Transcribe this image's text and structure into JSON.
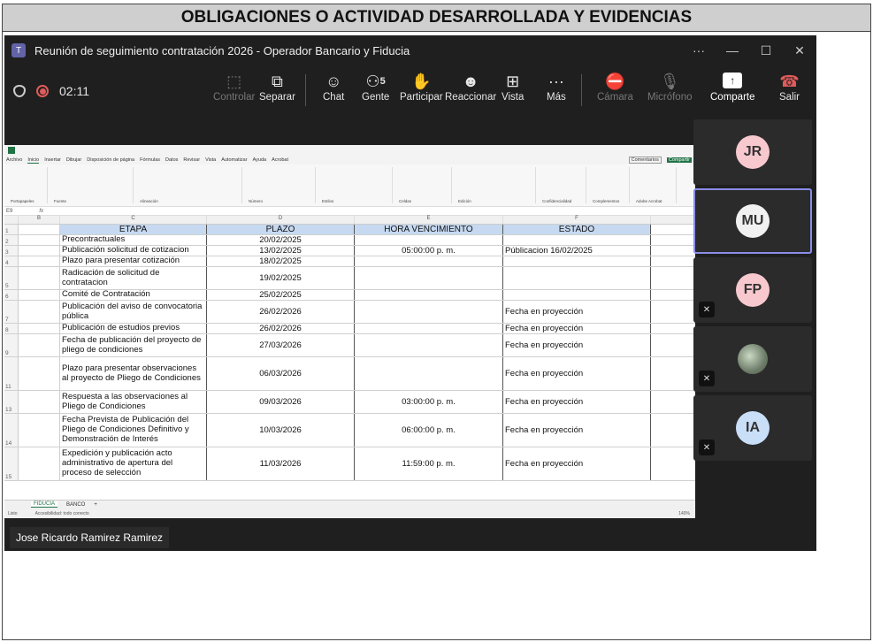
{
  "header": {
    "title": "OBLIGACIONES O ACTIVIDAD DESARROLLADA Y EVIDENCIAS"
  },
  "window": {
    "title": "Reunión de seguimiento contratación 2026 - Operador Bancario y Fiducia",
    "controls": [
      "···",
      "—",
      "☐",
      "✕"
    ]
  },
  "meeting": {
    "timer": "02:11",
    "people_count": "5",
    "buttons": [
      {
        "label": "Controlar",
        "icon": "control-icon"
      },
      {
        "label": "Separar",
        "icon": "popout-icon"
      },
      {
        "label": "Chat",
        "icon": "chat-icon"
      },
      {
        "label": "Gente",
        "icon": "people-icon"
      },
      {
        "label": "Participar",
        "icon": "raise-hand-icon"
      },
      {
        "label": "Reaccionar",
        "icon": "emoji-icon"
      },
      {
        "label": "Vista",
        "icon": "grid-icon"
      },
      {
        "label": "Más",
        "icon": "more-icon"
      },
      {
        "label": "Cámara",
        "icon": "camera-off-icon"
      },
      {
        "label": "Micrófono",
        "icon": "mic-off-icon"
      },
      {
        "label": "Comparte",
        "icon": "share-icon"
      },
      {
        "label": "Salir",
        "icon": "hangup-icon"
      }
    ]
  },
  "excel": {
    "menu": [
      "Archivo",
      "Inicio",
      "Insertar",
      "Dibujar",
      "Disposición de página",
      "Fórmulas",
      "Datos",
      "Revisar",
      "Vista",
      "Automatizar",
      "Ayuda",
      "Acrobat"
    ],
    "ribbon_groups": [
      "Portapapeles",
      "Fuente",
      "Alineación",
      "Número",
      "Estilos",
      "Celdas",
      "Edición",
      "Confidencialidad",
      "Complementos",
      "Adobe Acrobat"
    ],
    "ribbon_buttons": [
      "Comentarios",
      "Compartir"
    ],
    "cell_ref": "E9",
    "formula_prefix": "fx",
    "columns": [
      "B",
      "C",
      "D",
      "E",
      "F"
    ],
    "headers": {
      "etapa": "ETAPA",
      "plazo": "PLAZO",
      "hora": "HORA VENCIMIENTO",
      "estado": "ESTADO"
    },
    "rows": [
      {
        "n": "2",
        "etapa": "Precontractuales",
        "plazo": "20/02/2025",
        "hora": "",
        "estado": ""
      },
      {
        "n": "3",
        "etapa": "Publicación solicitud de cotizacion",
        "plazo": "13/02/2025",
        "hora": "05:00:00 p. m.",
        "estado": "Públicacion  16/02/2025"
      },
      {
        "n": "4",
        "etapa": "Plazo para presentar cotización",
        "plazo": "18/02/2025",
        "hora": "",
        "estado": ""
      },
      {
        "n": "5",
        "etapa": "Radicación de solicitud de contratacion",
        "plazo": "19/02/2025",
        "hora": "",
        "estado": ""
      },
      {
        "n": "6",
        "etapa": "Comité de Contratación",
        "plazo": "25/02/2025",
        "hora": "",
        "estado": ""
      },
      {
        "n": "7",
        "etapa": "Publicación del aviso de convocatoria pública",
        "plazo": "26/02/2026",
        "hora": "",
        "estado": "Fecha en proyección"
      },
      {
        "n": "8",
        "etapa": "Publicación de estudios previos",
        "plazo": "26/02/2026",
        "hora": "",
        "estado": "Fecha en proyección"
      },
      {
        "n": "9",
        "etapa": "Fecha de publicación del proyecto de pliego de condiciones",
        "plazo": "27/03/2026",
        "hora": "",
        "estado": "Fecha en proyección"
      },
      {
        "n": "11",
        "etapa": "Plazo para presentar observaciones al proyecto de Pliego de Condiciones",
        "plazo": "06/03/2026",
        "hora": "",
        "estado": "Fecha en proyección"
      },
      {
        "n": "13",
        "etapa": "Respuesta a las observaciones al Pliego de Condiciones",
        "plazo": "09/03/2026",
        "hora": "03:00:00 p. m.",
        "estado": "Fecha en proyección"
      },
      {
        "n": "14",
        "etapa": "Fecha Prevista de Publicación del Pliego de Condiciones Definitivo y Demonstración de Interés",
        "plazo": "10/03/2026",
        "hora": "06:00:00 p. m.",
        "estado": "Fecha en proyección"
      },
      {
        "n": "15",
        "etapa": "Expedición y publicación acto administrativo de apertura del proceso de selección",
        "plazo": "11/03/2026",
        "hora": "11:59:00 p. m.",
        "estado": "Fecha en proyección"
      }
    ],
    "sheets": [
      "FIDUCIA",
      "BANCO",
      "+"
    ],
    "status": [
      "Listo",
      "Accesibilidad: todo correcto"
    ],
    "zoom": "140%"
  },
  "participants": [
    {
      "initials": "JR",
      "color": "#f7c9cf",
      "muted": false
    },
    {
      "initials": "MU",
      "color": "#f1f1f1",
      "muted": false,
      "selected": true
    },
    {
      "initials": "FP",
      "color": "#f7c9cf",
      "muted": true
    },
    {
      "initials": "",
      "color": "",
      "muted": true,
      "photo": true
    },
    {
      "initials": "IA",
      "color": "#c9def7",
      "muted": true
    }
  ],
  "presenter": "Jose Ricardo Ramirez Ramirez"
}
